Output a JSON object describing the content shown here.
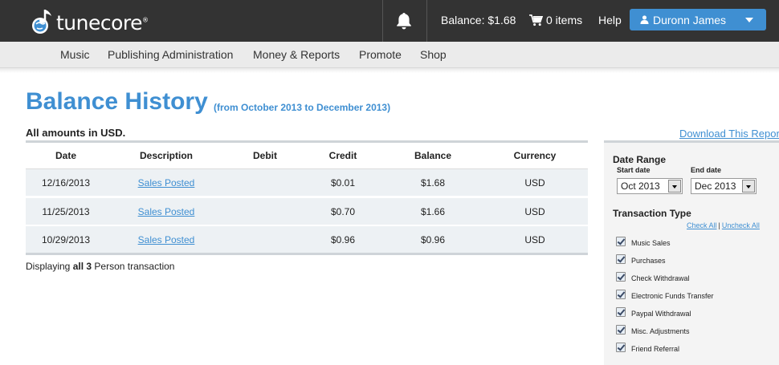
{
  "header": {
    "logo_text": "tunecore",
    "logo_tm": "®",
    "balance": "Balance: $1.68",
    "cart": "0 items",
    "help": "Help",
    "user_name": "Duronn James"
  },
  "nav": {
    "items": [
      "Music",
      "Publishing Administration",
      "Money & Reports",
      "Promote",
      "Shop"
    ]
  },
  "page": {
    "title": "Balance History",
    "subtitle": "(from October 2013 to December 2013)",
    "amounts_note": "All amounts in USD.",
    "download_link": "Download This Report"
  },
  "table": {
    "columns": [
      "Date",
      "Description",
      "Debit",
      "Credit",
      "Balance",
      "Currency"
    ],
    "rows": [
      {
        "date": "12/16/2013",
        "description": "Sales Posted",
        "debit": "",
        "credit": "$0.01",
        "balance": "$1.68",
        "currency": "USD"
      },
      {
        "date": "11/25/2013",
        "description": "Sales Posted",
        "debit": "",
        "credit": "$0.70",
        "balance": "$1.66",
        "currency": "USD"
      },
      {
        "date": "10/29/2013",
        "description": "Sales Posted",
        "debit": "",
        "credit": "$0.96",
        "balance": "$0.96",
        "currency": "USD"
      }
    ],
    "footer_prefix": "Displaying ",
    "footer_bold": "all 3",
    "footer_suffix": " Person transaction"
  },
  "sidebar": {
    "date_range_label": "Date Range",
    "start_label": "Start date",
    "end_label": "End date",
    "start_value": "Oct 2013",
    "end_value": "Dec 2013",
    "transaction_type_label": "Transaction Type",
    "check_all": "Check All",
    "uncheck_all": "Uncheck All",
    "types": [
      {
        "label": "Music Sales",
        "checked": true
      },
      {
        "label": "Purchases",
        "checked": true
      },
      {
        "label": "Check Withdrawal",
        "checked": true
      },
      {
        "label": "Electronic Funds Transfer",
        "checked": true
      },
      {
        "label": "Paypal Withdrawal",
        "checked": true
      },
      {
        "label": "Misc. Adjustments",
        "checked": true
      },
      {
        "label": "Friend Referral",
        "checked": true
      }
    ]
  },
  "colors": {
    "topbar": "#333333",
    "accent": "#3f8fd2",
    "row_bg": "#edf1f4"
  }
}
